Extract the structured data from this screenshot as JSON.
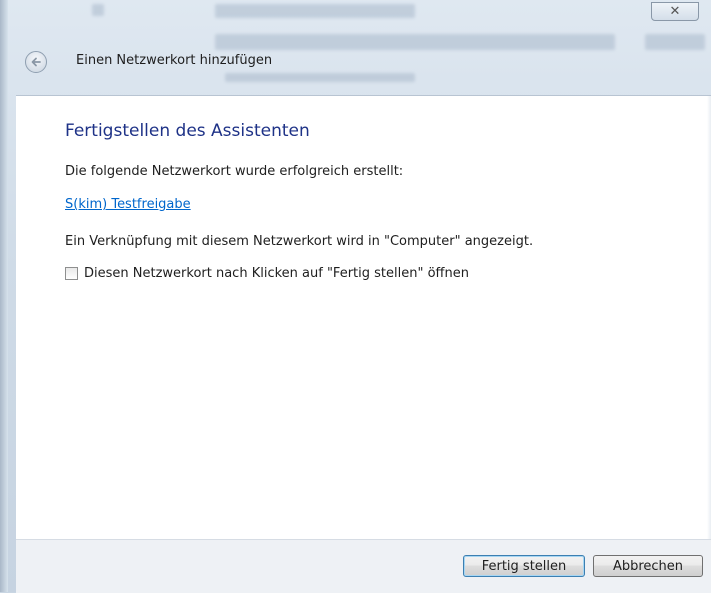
{
  "window": {
    "title": "Einen Netzwerkort hinzufügen",
    "close_glyph": "✕"
  },
  "wizard": {
    "heading": "Fertigstellen des Assistenten",
    "success_text": "Die folgende Netzwerkort wurde erfolgreich erstellt:",
    "location_link": "S(kim) Testfreigabe",
    "info_text": "Ein Verknüpfung mit diesem Netzwerkort wird in \"Computer\" angezeigt.",
    "open_checkbox": {
      "label": "Diesen Netzwerkort nach Klicken auf \"Fertig stellen\" öffnen",
      "checked": false
    }
  },
  "footer": {
    "finish_label": "Fertig stellen",
    "cancel_label": "Abbrechen"
  },
  "colors": {
    "heading": "#1e3287",
    "link": "#0066cc",
    "footer_bg": "#eef1f5"
  }
}
